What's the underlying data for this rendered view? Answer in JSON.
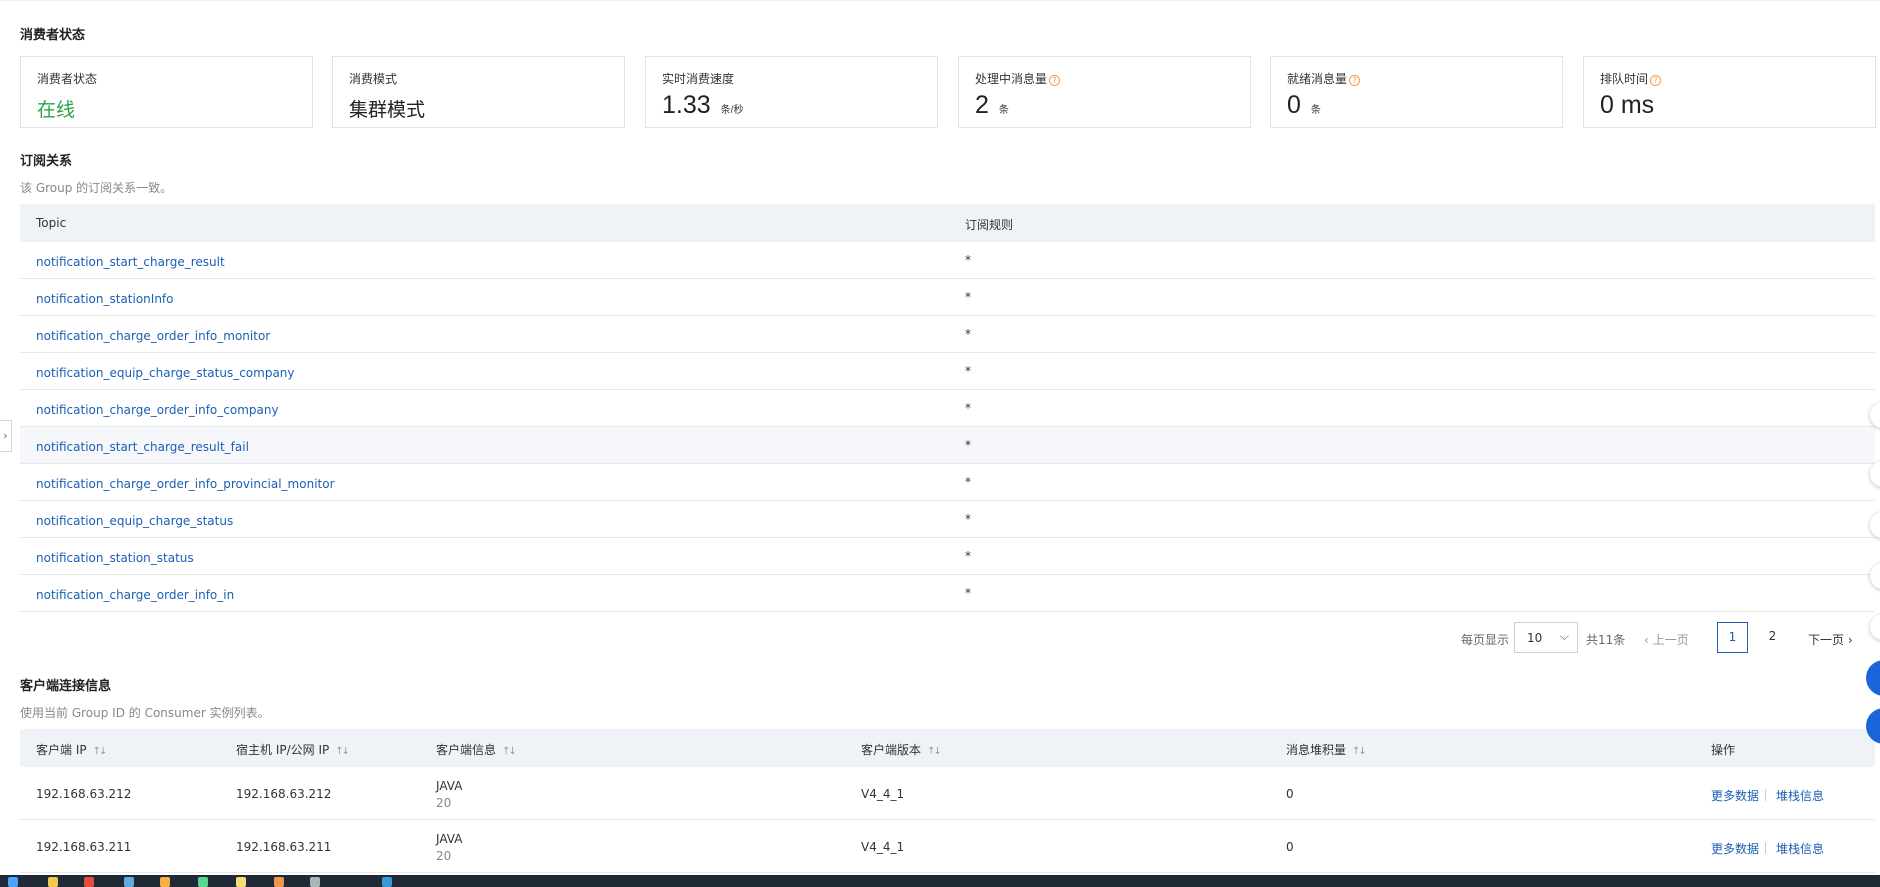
{
  "consumer_status": {
    "title": "消费者状态",
    "cards": [
      {
        "label": "消费者状态",
        "value": "在线",
        "unit": "",
        "help": false
      },
      {
        "label": "消费模式",
        "value": "集群模式",
        "unit": "",
        "help": false
      },
      {
        "label": "实时消费速度",
        "value": "1.33",
        "unit": "条/秒",
        "help": false
      },
      {
        "label": "处理中消息量",
        "value": "2",
        "unit": "条",
        "help": true
      },
      {
        "label": "就绪消息量",
        "value": "0",
        "unit": "条",
        "help": true
      },
      {
        "label": "排队时间",
        "value": "0 ms",
        "unit": "",
        "help": true
      }
    ],
    "colors": {
      "online": "#2aa345",
      "help_icon": "#f0a04b"
    }
  },
  "subscription": {
    "title": "订阅关系",
    "desc": "该 Group 的订阅关系一致。",
    "columns": [
      "Topic",
      "订阅规则"
    ],
    "rows": [
      {
        "topic": "notification_start_charge_result",
        "rule": "*"
      },
      {
        "topic": "notification_stationInfo",
        "rule": "*"
      },
      {
        "topic": "notification_charge_order_info_monitor",
        "rule": "*"
      },
      {
        "topic": "notification_equip_charge_status_company",
        "rule": "*"
      },
      {
        "topic": "notification_charge_order_info_company",
        "rule": "*"
      },
      {
        "topic": "notification_start_charge_result_fail",
        "rule": "*"
      },
      {
        "topic": "notification_charge_order_info_provincial_monitor",
        "rule": "*"
      },
      {
        "topic": "notification_equip_charge_status",
        "rule": "*"
      },
      {
        "topic": "notification_station_status",
        "rule": "*"
      },
      {
        "topic": "notification_charge_order_info_in",
        "rule": "*"
      }
    ],
    "pagination": {
      "page_size_label": "每页显示",
      "page_size": "10",
      "total": "共11条",
      "prev": "上一页",
      "pages": [
        "1",
        "2"
      ],
      "current": "1",
      "next": "下一页"
    }
  },
  "clients": {
    "title": "客户端连接信息",
    "desc": "使用当前 Group ID 的 Consumer 实例列表。",
    "columns": [
      "客户端 IP",
      "宿主机 IP/公网 IP",
      "客户端信息",
      "客户端版本",
      "消息堆积量",
      "操作"
    ],
    "rows": [
      {
        "ip": "192.168.63.212",
        "host_ip": "192.168.63.212",
        "lang": "JAVA",
        "lang_ver": "20",
        "version": "V4_4_1",
        "backlog": "0",
        "action1": "更多数据",
        "action2": "堆栈信息"
      },
      {
        "ip": "192.168.63.211",
        "host_ip": "192.168.63.211",
        "lang": "JAVA",
        "lang_ver": "20",
        "version": "V4_4_1",
        "backlog": "0",
        "action1": "更多数据",
        "action2": "堆栈信息"
      }
    ]
  },
  "icons": {
    "sort": "sort-icon",
    "help": "question-circle-icon",
    "chevron_left": "chevron-left-icon",
    "chevron_right": "chevron-right-icon",
    "chevron_down": "chevron-down-icon",
    "sidebar_toggle": "expand-sidebar-icon"
  },
  "accent_color": "#1a5fb4"
}
